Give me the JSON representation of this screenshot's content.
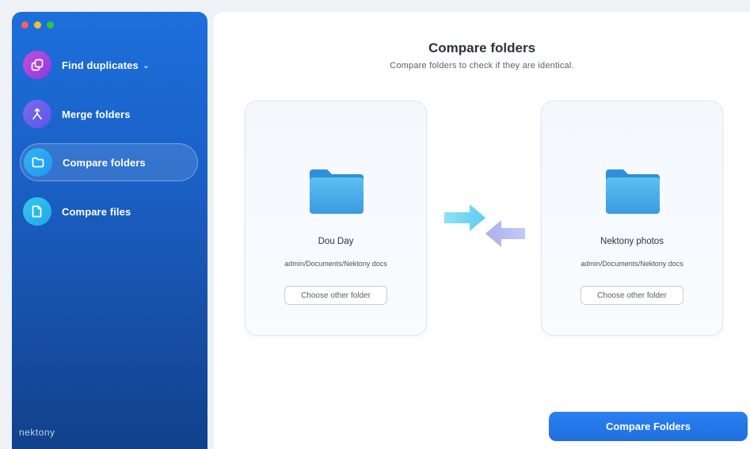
{
  "window": {
    "traffic_lights": [
      "close",
      "minimize",
      "zoom"
    ]
  },
  "sidebar": {
    "items": [
      {
        "label": "Find duplicates",
        "icon": "duplicate-icon",
        "has_dropdown": true,
        "active": false
      },
      {
        "label": "Merge folders",
        "icon": "merge-icon",
        "active": false
      },
      {
        "label": "Compare folders",
        "icon": "folder-icon",
        "active": true
      },
      {
        "label": "Compare files",
        "icon": "file-icon",
        "active": false
      }
    ],
    "brand": "nektony"
  },
  "main": {
    "title": "Compare folders",
    "subtitle": "Compare folders to check if they are identical.",
    "left_folder": {
      "name": "Dou Day",
      "path": "admin/Documents/Nektony docs",
      "button_label": "Choose other folder"
    },
    "right_folder": {
      "name": "Nektony photos",
      "path": "admin/Documents/Nektony docs",
      "button_label": "Choose other folder"
    },
    "compare_button": "Compare Folders"
  },
  "colors": {
    "sidebar_top": "#1c6fdc",
    "sidebar_bottom": "#10418b",
    "accent": "#2b7ff0",
    "folder_blue": "#4aaee8"
  }
}
